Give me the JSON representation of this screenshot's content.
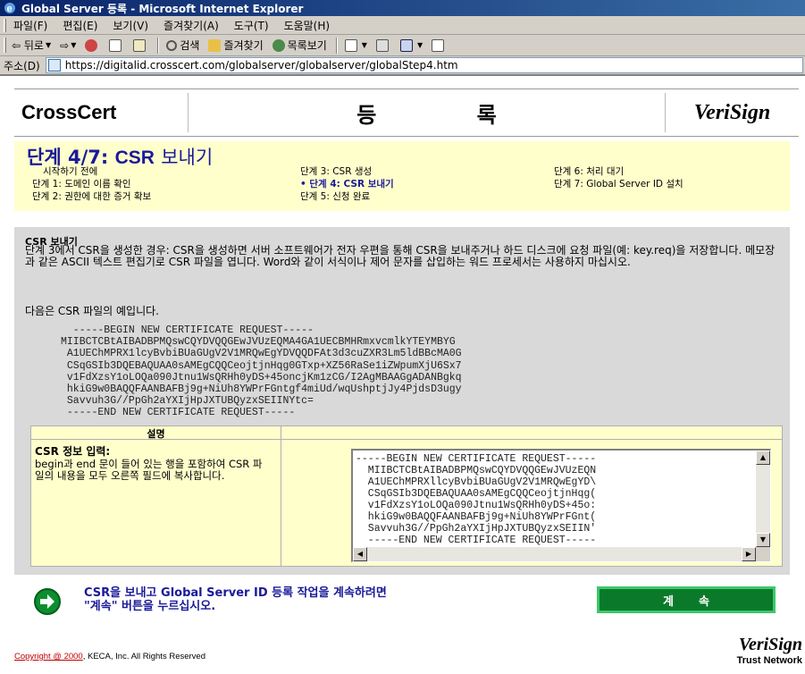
{
  "window": {
    "title": "Global Server 등록 - Microsoft Internet Explorer"
  },
  "menu": [
    "파일(F)",
    "편집(E)",
    "보기(V)",
    "즐겨찾기(A)",
    "도구(T)",
    "도움말(H)"
  ],
  "toolbar": {
    "back": "뒤로",
    "search": "검색",
    "favorites": "즐겨찾기",
    "history": "목록보기"
  },
  "address": {
    "label": "주소(D)",
    "url": "https://digitalid.crosscert.com/globalserver/globalserver/globalStep4.htm"
  },
  "header": {
    "brand": "CrossCert",
    "title": "등 록",
    "partner": "VeriSign"
  },
  "steps": {
    "heading_prefix": "단계 4/7:",
    "heading_csr": "CSR",
    "heading_suffix": "보내기",
    "col1": [
      "시작하기 전에",
      "단계 1: 도메인 이름 확인",
      "단계 2: 권한에 대한 증거 확보"
    ],
    "col2": [
      "단계 3: CSR 생성",
      "단계 4: CSR 보내기",
      "단계 5: 신청 완료"
    ],
    "col3": [
      "단계 6: 처리 대기",
      "단계 7: Global Server ID 설치"
    ]
  },
  "section": {
    "title": "CSR 보내기",
    "description": "단계 3에서 CSR을 생성한 경우: CSR을 생성하면 서버 소프트웨어가 전자 우편을 통해 CSR을 보내주거나 하드 디스크에 요청 파일(예: key.req)을 저장합니다. 메모장과 같은 ASCII 텍스트 편집기로 CSR 파일을 엽니다. Word와 같이 서식이나 제어 문자를 삽입하는 워드 프로세서는 사용하지 마십시오.",
    "example_label": "다음은 CSR 파일의 예입니다.",
    "csr_sample": "  -----BEGIN NEW CERTIFICATE REQUEST-----\nMIIBCTCBtAIBADBPMQswCQYDVQQGEwJVUzEQMA4GA1UECBMHRmxvcmlkYTEYMBYG\n A1UEChMPRX1lcyBvbiBUaGUgV2V1MRQwEgYDVQQDFAt3d3cuZXR3Lm5ldBBcMA0G\n CSqGSIb3DQEBAQUAA0sAMEgCQQCeojtjnHqg0GTxp+XZ56RaSe1iZWpumXjU6Sx7\n v1FdXzsY1oLOQa090Jtnu1WsQRHh0yDS+45oncjKm1zCG/I2AgMBAAGgADANBgkq\n hkiG9w0BAQQFAANBAFBj9g+NiUh8YWPrFGntgf4miUd/wqUshptjJy4PjdsD3ugy\n Savvuh3G//PpGh2aYXIjHpJXTUBQyzxSEIINYtc=\n -----END NEW CERTIFICATE REQUEST-----"
  },
  "table": {
    "header": "설명",
    "label": "CSR 정보 입력:",
    "instruction": "begin과 end 문이 들어 있는 행을 포함하여 CSR 파일의 내용을 모두 오른쪽 필드에 복사합니다.",
    "csr_value": "-----BEGIN NEW CERTIFICATE REQUEST-----\n  MIIBCTCBtAIBADBPMQswCQYDVQQGEwJVUzEQN\n  A1UEChMPRXllcyBvbiBUaGUgV2V1MRQwEgYD\\\n  CSqGSIb3DQEBAQUAA0sAMEgCQQCeojtjnHqg(\n  v1FdXzsY1oLOQa090Jtnu1WsQRHh0yDS+45o:\n  hkiG9w0BAQQFAANBAFBj9g+NiUh8YWPrFGnt(\n  Savvuh3G//PpGh2aYXIjHpJXTUBQyzxSEIIN'\n  -----END NEW CERTIFICATE REQUEST-----"
  },
  "action": {
    "line1": "CSR을 보내고 Global Server ID 등록 작업을 계속하려면",
    "line2": "\"계속\" 버튼을 누르십시오.",
    "button": "계속"
  },
  "footer": {
    "copyright_link": "Copyright @ 2000",
    "copyright_rest": ", KECA, Inc. All Rights Reserved",
    "logo": "VeriSign",
    "logo_sub": "Trust Network"
  },
  "colors": {
    "title_bar": "#0a246a",
    "steps_bg": "#ffffcc",
    "heading": "#1a1a99",
    "main_bg": "#d9d9d9",
    "button_green": "#0a7a2a"
  }
}
